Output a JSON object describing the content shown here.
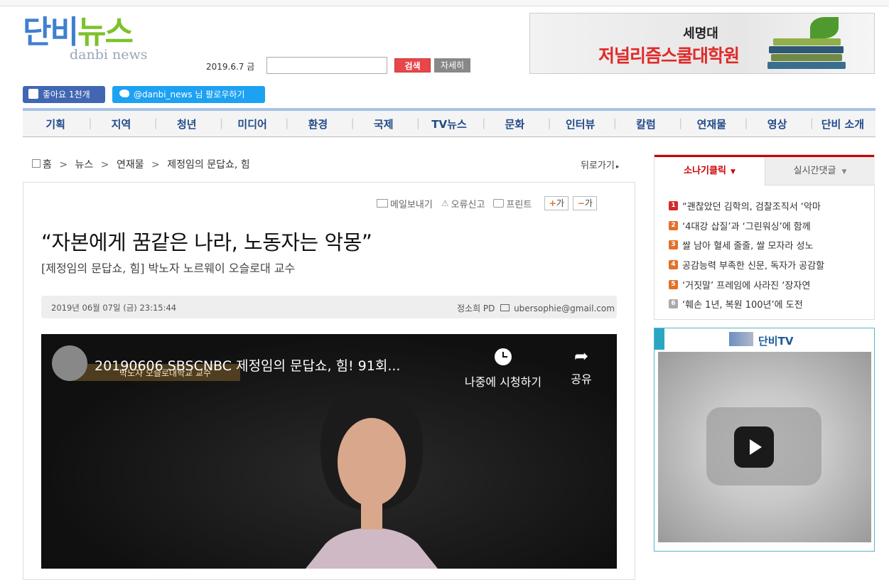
{
  "site": {
    "logo_ko_1": "단비",
    "logo_ko_2": "뉴스",
    "logo_en": "danbi news",
    "date": "2019.6.7 금",
    "search_placeholder": "",
    "search_button": "검색",
    "detail_button": "자세히",
    "colors": {
      "logo_blue": "#3f7fd0",
      "logo_green": "#7cc22a",
      "nav_text": "#234a8a",
      "accent_red": "#c00000"
    }
  },
  "banner": {
    "line1": "세명대",
    "line2": "저널리즘스쿨대학원"
  },
  "social": {
    "fb_like": "좋아요 1천개",
    "tw_follow": "@danbi_news 님 팔로우하기"
  },
  "nav": {
    "items": [
      "기획",
      "지역",
      "청년",
      "미디어",
      "환경",
      "국제",
      "TV뉴스",
      "문화",
      "인터뷰",
      "칼럼",
      "연재물",
      "영상",
      "단비 소개"
    ]
  },
  "breadcrumb": {
    "home": "홈",
    "sep": ">",
    "l1": "뉴스",
    "l2": "연재물",
    "l3": "제정임의 문답쇼, 힘",
    "back": "뒤로가기"
  },
  "tools": {
    "mail": "메일보내기",
    "report": "오류신고",
    "print": "프린트",
    "font_up": "가",
    "font_down": "가"
  },
  "article": {
    "headline": "“자본에게 꿈같은 나라, 노동자는 악몽”",
    "subhead": "[제정임의 문답쇼, 힘] 박노자 노르웨이 오슬로대 교수",
    "datetime": "2019년 06월 07일 (금) 23:15:44",
    "author": "정소희 PD",
    "email": "ubersophie@gmail.com"
  },
  "video": {
    "title": "20190606 SBSCNBC 제정임의 문답쇼, 힘! 91회...",
    "caption": "박노자 오슬로대학교 교수",
    "watch_later": "나중에 시청하기",
    "share": "공유"
  },
  "sidebar": {
    "tab_active": "소나기클릭",
    "tab_inactive": "실시간댓글",
    "ranks": [
      {
        "num": "1",
        "title": "“괜찮았던 김학의, 검찰조직서 ‘악마",
        "color": "#d32a2a"
      },
      {
        "num": "2",
        "title": "‘4대강 삽질’과 ‘그린워싱’에 함께",
        "color": "#e2712b"
      },
      {
        "num": "3",
        "title": "쌀 남아 혈세 줄줄, 쌀 모자라 성노",
        "color": "#e2712b"
      },
      {
        "num": "4",
        "title": "공감능력 부족한 신문, 독자가 공감할",
        "color": "#e2712b"
      },
      {
        "num": "5",
        "title": "‘거짓말’ 프레임에 사라진 ‘장자연",
        "color": "#e2712b"
      },
      {
        "num": "6",
        "title": "‘훼손 1년, 복원 100년’에 도전",
        "color": "#aaaaaa"
      }
    ],
    "tv_title": "단비TV"
  }
}
